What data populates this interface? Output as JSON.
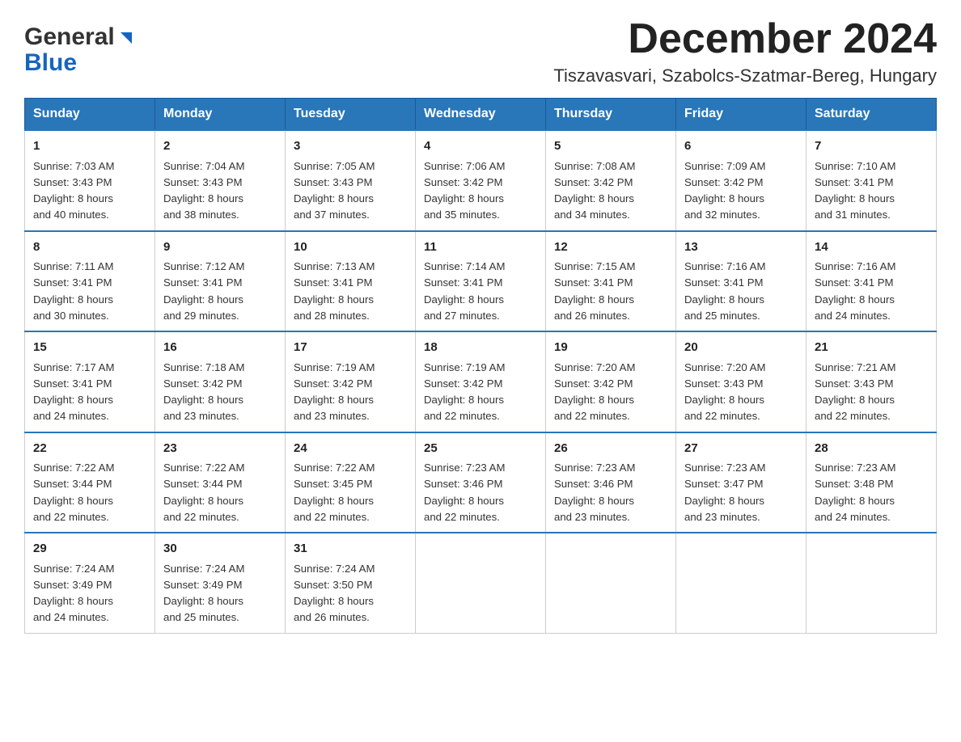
{
  "header": {
    "logo_line1": "General",
    "logo_line2": "Blue",
    "title": "December 2024",
    "subtitle": "Tiszavasvari, Szabolcs-Szatmar-Bereg, Hungary"
  },
  "days_of_week": [
    "Sunday",
    "Monday",
    "Tuesday",
    "Wednesday",
    "Thursday",
    "Friday",
    "Saturday"
  ],
  "weeks": [
    [
      {
        "num": "1",
        "sunrise": "7:03 AM",
        "sunset": "3:43 PM",
        "daylight": "8 hours and 40 minutes."
      },
      {
        "num": "2",
        "sunrise": "7:04 AM",
        "sunset": "3:43 PM",
        "daylight": "8 hours and 38 minutes."
      },
      {
        "num": "3",
        "sunrise": "7:05 AM",
        "sunset": "3:43 PM",
        "daylight": "8 hours and 37 minutes."
      },
      {
        "num": "4",
        "sunrise": "7:06 AM",
        "sunset": "3:42 PM",
        "daylight": "8 hours and 35 minutes."
      },
      {
        "num": "5",
        "sunrise": "7:08 AM",
        "sunset": "3:42 PM",
        "daylight": "8 hours and 34 minutes."
      },
      {
        "num": "6",
        "sunrise": "7:09 AM",
        "sunset": "3:42 PM",
        "daylight": "8 hours and 32 minutes."
      },
      {
        "num": "7",
        "sunrise": "7:10 AM",
        "sunset": "3:41 PM",
        "daylight": "8 hours and 31 minutes."
      }
    ],
    [
      {
        "num": "8",
        "sunrise": "7:11 AM",
        "sunset": "3:41 PM",
        "daylight": "8 hours and 30 minutes."
      },
      {
        "num": "9",
        "sunrise": "7:12 AM",
        "sunset": "3:41 PM",
        "daylight": "8 hours and 29 minutes."
      },
      {
        "num": "10",
        "sunrise": "7:13 AM",
        "sunset": "3:41 PM",
        "daylight": "8 hours and 28 minutes."
      },
      {
        "num": "11",
        "sunrise": "7:14 AM",
        "sunset": "3:41 PM",
        "daylight": "8 hours and 27 minutes."
      },
      {
        "num": "12",
        "sunrise": "7:15 AM",
        "sunset": "3:41 PM",
        "daylight": "8 hours and 26 minutes."
      },
      {
        "num": "13",
        "sunrise": "7:16 AM",
        "sunset": "3:41 PM",
        "daylight": "8 hours and 25 minutes."
      },
      {
        "num": "14",
        "sunrise": "7:16 AM",
        "sunset": "3:41 PM",
        "daylight": "8 hours and 24 minutes."
      }
    ],
    [
      {
        "num": "15",
        "sunrise": "7:17 AM",
        "sunset": "3:41 PM",
        "daylight": "8 hours and 24 minutes."
      },
      {
        "num": "16",
        "sunrise": "7:18 AM",
        "sunset": "3:42 PM",
        "daylight": "8 hours and 23 minutes."
      },
      {
        "num": "17",
        "sunrise": "7:19 AM",
        "sunset": "3:42 PM",
        "daylight": "8 hours and 23 minutes."
      },
      {
        "num": "18",
        "sunrise": "7:19 AM",
        "sunset": "3:42 PM",
        "daylight": "8 hours and 22 minutes."
      },
      {
        "num": "19",
        "sunrise": "7:20 AM",
        "sunset": "3:42 PM",
        "daylight": "8 hours and 22 minutes."
      },
      {
        "num": "20",
        "sunrise": "7:20 AM",
        "sunset": "3:43 PM",
        "daylight": "8 hours and 22 minutes."
      },
      {
        "num": "21",
        "sunrise": "7:21 AM",
        "sunset": "3:43 PM",
        "daylight": "8 hours and 22 minutes."
      }
    ],
    [
      {
        "num": "22",
        "sunrise": "7:22 AM",
        "sunset": "3:44 PM",
        "daylight": "8 hours and 22 minutes."
      },
      {
        "num": "23",
        "sunrise": "7:22 AM",
        "sunset": "3:44 PM",
        "daylight": "8 hours and 22 minutes."
      },
      {
        "num": "24",
        "sunrise": "7:22 AM",
        "sunset": "3:45 PM",
        "daylight": "8 hours and 22 minutes."
      },
      {
        "num": "25",
        "sunrise": "7:23 AM",
        "sunset": "3:46 PM",
        "daylight": "8 hours and 22 minutes."
      },
      {
        "num": "26",
        "sunrise": "7:23 AM",
        "sunset": "3:46 PM",
        "daylight": "8 hours and 23 minutes."
      },
      {
        "num": "27",
        "sunrise": "7:23 AM",
        "sunset": "3:47 PM",
        "daylight": "8 hours and 23 minutes."
      },
      {
        "num": "28",
        "sunrise": "7:23 AM",
        "sunset": "3:48 PM",
        "daylight": "8 hours and 24 minutes."
      }
    ],
    [
      {
        "num": "29",
        "sunrise": "7:24 AM",
        "sunset": "3:49 PM",
        "daylight": "8 hours and 24 minutes."
      },
      {
        "num": "30",
        "sunrise": "7:24 AM",
        "sunset": "3:49 PM",
        "daylight": "8 hours and 25 minutes."
      },
      {
        "num": "31",
        "sunrise": "7:24 AM",
        "sunset": "3:50 PM",
        "daylight": "8 hours and 26 minutes."
      },
      null,
      null,
      null,
      null
    ]
  ],
  "labels": {
    "sunrise": "Sunrise:",
    "sunset": "Sunset:",
    "daylight": "Daylight:"
  }
}
